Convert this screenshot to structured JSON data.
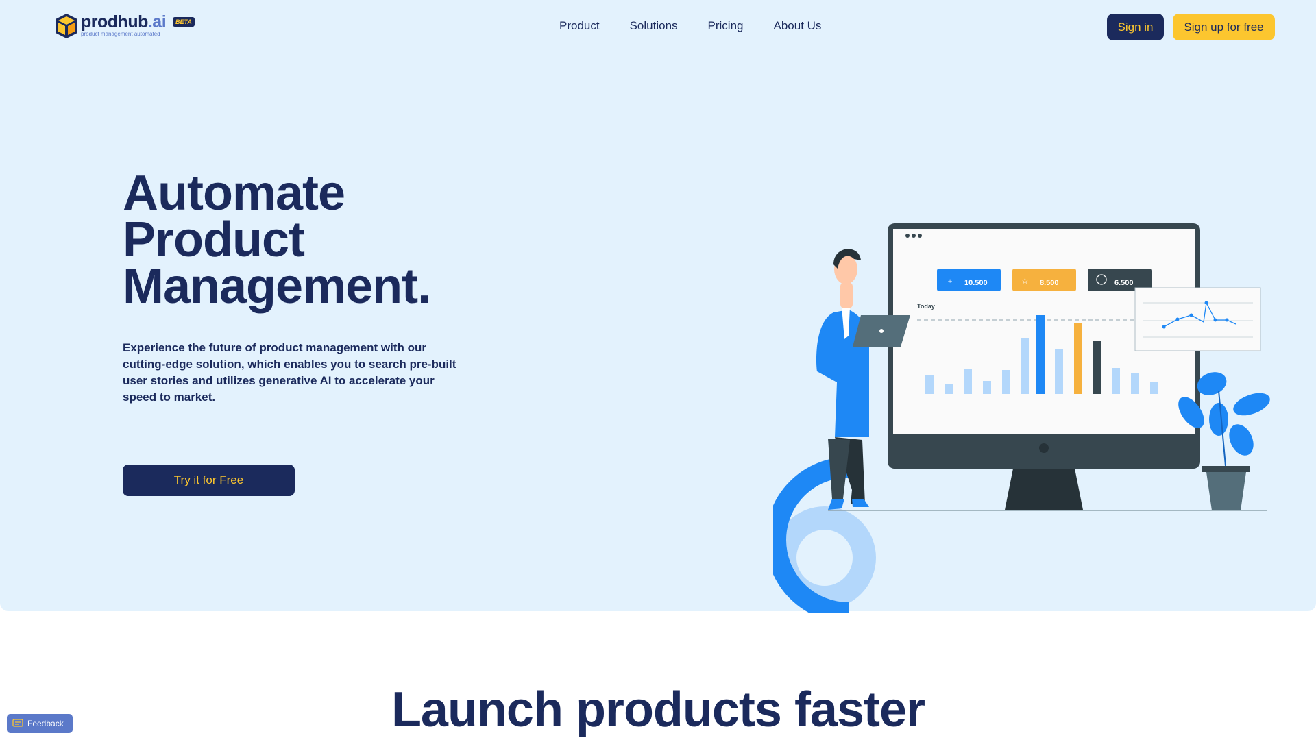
{
  "brand": {
    "name": "prodhub",
    "suffix": ".ai",
    "badge": "BETA",
    "tagline": "product management automated"
  },
  "nav": {
    "items": [
      {
        "label": "Product"
      },
      {
        "label": "Solutions"
      },
      {
        "label": "Pricing"
      },
      {
        "label": "About Us"
      }
    ]
  },
  "auth": {
    "sign_in": "Sign in",
    "sign_up": "Sign up for free"
  },
  "hero": {
    "title_lines": [
      "Automate",
      "Product",
      "Management."
    ],
    "description": "Experience the future of product management with our cutting-edge solution, which enables you to search pre-built user stories and utilizes generative AI to accelerate your speed to market.",
    "cta": "Try it for Free"
  },
  "illustration": {
    "stats": [
      {
        "value": "10.500",
        "icon": "cursor-icon",
        "color": "#1e88f5"
      },
      {
        "value": "8.500",
        "icon": "star-icon",
        "color": "#f6b13e"
      },
      {
        "value": "6.500",
        "icon": "download-icon",
        "color": "#37474f"
      }
    ],
    "chart_label": "Today"
  },
  "section": {
    "title": "Launch products faster"
  },
  "feedback": {
    "label": "Feedback"
  },
  "colors": {
    "navy": "#1b2a5c",
    "accent_yellow": "#fcc62f",
    "hero_bg": "#e3f2fd",
    "blue": "#1e88f5"
  }
}
